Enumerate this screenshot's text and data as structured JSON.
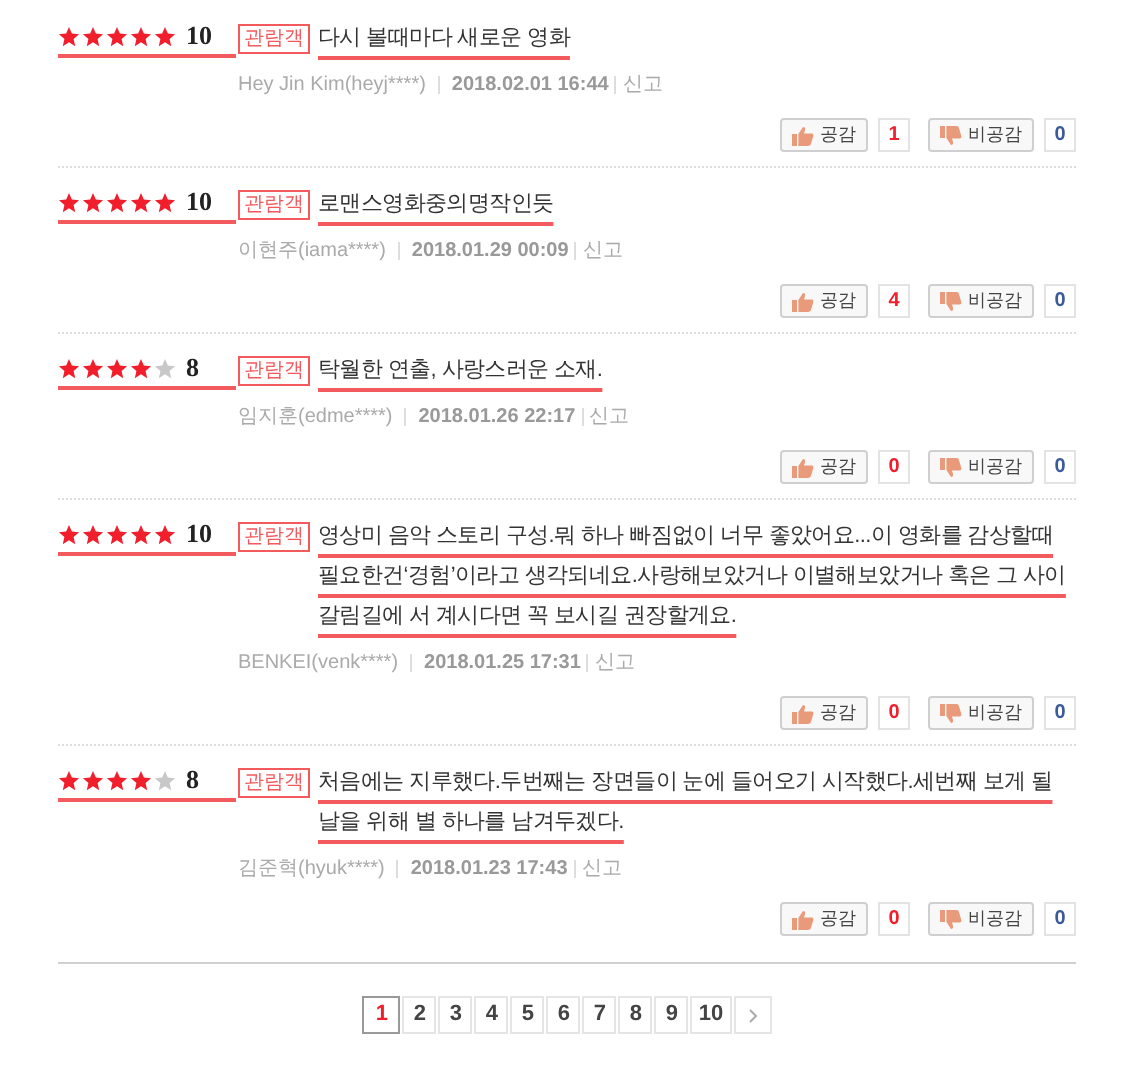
{
  "reviews": [
    {
      "stars": 5,
      "score": "10",
      "badge": "관람객",
      "text": "다시 볼때마다 새로운 영화",
      "author": "Hey Jin Kim(heyj****)",
      "date": "2018.02.01 16:44",
      "report": "신고",
      "like_label": "공감",
      "like_count": "1",
      "dislike_label": "비공감",
      "dislike_count": "0"
    },
    {
      "stars": 5,
      "score": "10",
      "badge": "관람객",
      "text": "로맨스영화중의명작인듯",
      "author": "이현주(iama****)",
      "date": "2018.01.29 00:09",
      "report": "신고",
      "like_label": "공감",
      "like_count": "4",
      "dislike_label": "비공감",
      "dislike_count": "0"
    },
    {
      "stars": 4,
      "score": "8",
      "badge": "관람객",
      "text": "탁월한 연출, 사랑스러운 소재.",
      "author": "임지훈(edme****)",
      "date": "2018.01.26 22:17",
      "report": "신고",
      "like_label": "공감",
      "like_count": "0",
      "dislike_label": "비공감",
      "dislike_count": "0"
    },
    {
      "stars": 5,
      "score": "10",
      "badge": "관람객",
      "text": "영상미 음악 스토리 구성.뭐 하나 빠짐없이 너무 좋았어요...이 영화를 감상할때 필요한건‘경험’이라고 생각되네요.사랑해보았거나 이별해보았거나 혹은 그 사이 갈림길에 서 계시다면 꼭 보시길 권장할게요.",
      "author": "BENKEI(venk****)",
      "date": "2018.01.25 17:31",
      "report": "신고",
      "like_label": "공감",
      "like_count": "0",
      "dislike_label": "비공감",
      "dislike_count": "0"
    },
    {
      "stars": 4,
      "score": "8",
      "badge": "관람객",
      "text": "처음에는 지루했다.두번째는 장면들이 눈에 들어오기 시작했다.세번째 보게 될 날을 위해 별 하나를 남겨두겠다.",
      "author": "김준혁(hyuk****)",
      "date": "2018.01.23 17:43",
      "report": "신고",
      "like_label": "공감",
      "like_count": "0",
      "dislike_label": "비공감",
      "dislike_count": "0"
    }
  ],
  "pagination": [
    {
      "label": "1",
      "selected": true
    },
    {
      "label": "2",
      "selected": false
    },
    {
      "label": "3",
      "selected": false
    },
    {
      "label": "4",
      "selected": false
    },
    {
      "label": "5",
      "selected": false
    },
    {
      "label": "6",
      "selected": false
    },
    {
      "label": "7",
      "selected": false
    },
    {
      "label": "8",
      "selected": false
    },
    {
      "label": "9",
      "selected": false
    },
    {
      "label": "10",
      "selected": false
    }
  ]
}
